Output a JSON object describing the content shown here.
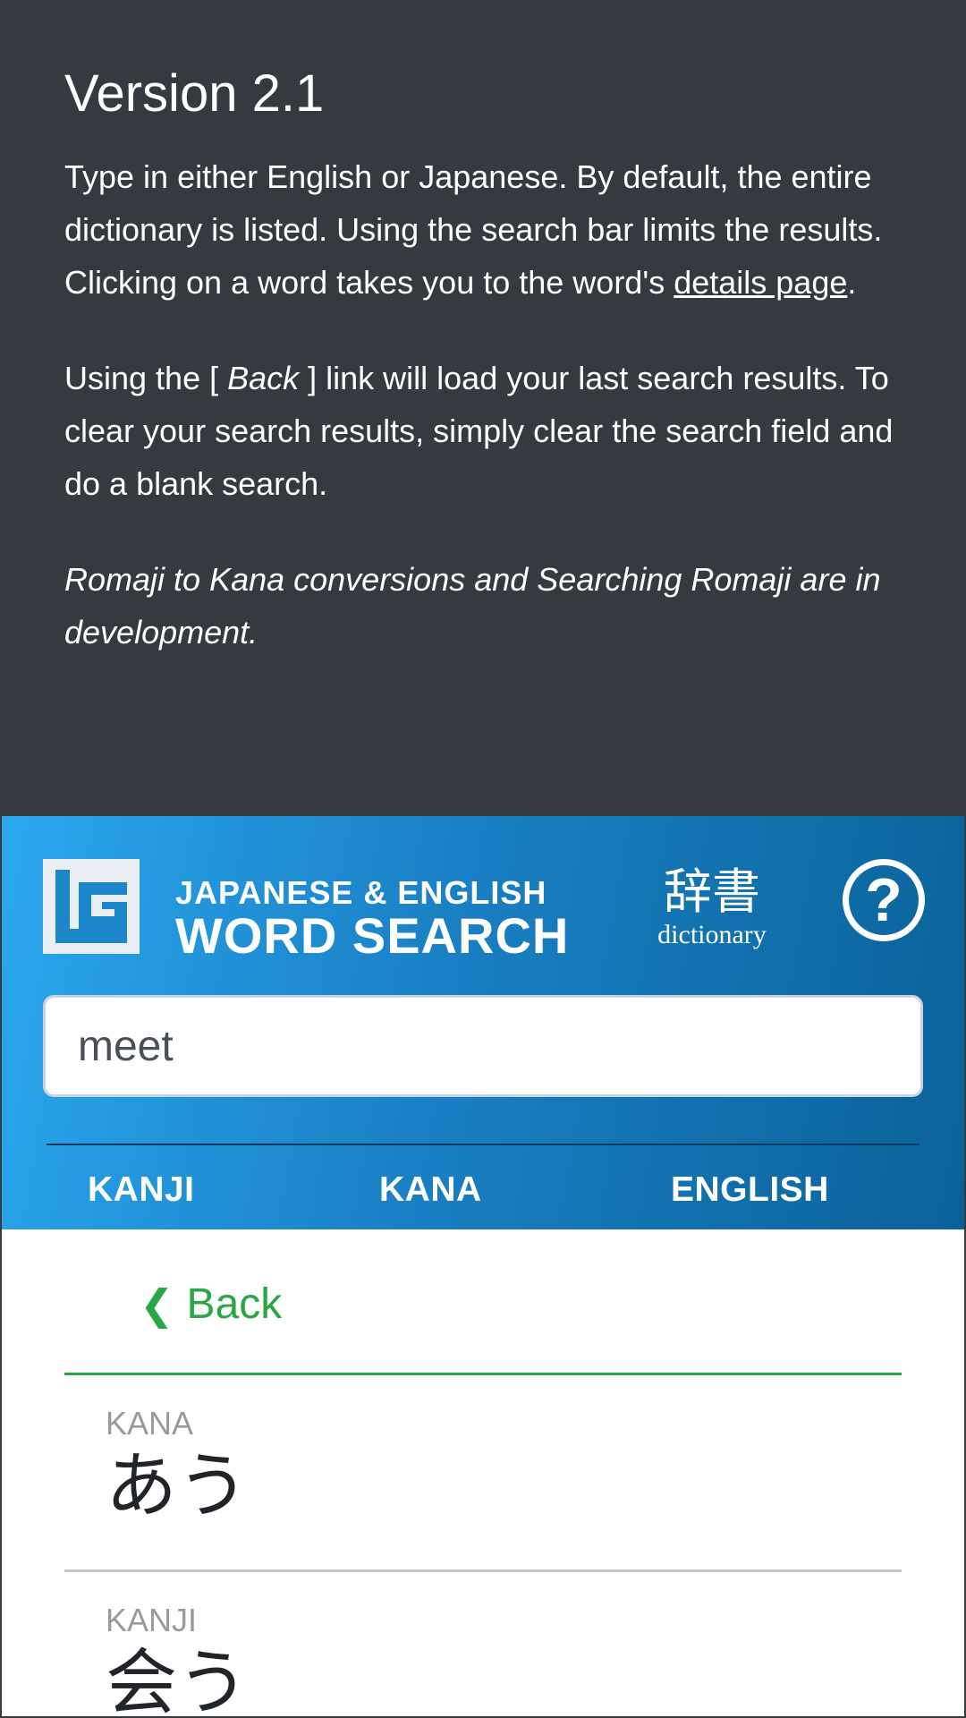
{
  "info": {
    "version_title": "Version 2.1",
    "p1_text": "Type in either English or Japanese. By default, the entire dictionary is listed. Using the search bar limits the results. Clicking on a word takes you to the word's ",
    "p1_link": "details page",
    "p1_end": ".",
    "p2_pre": "Using the [ ",
    "p2_em": "Back",
    "p2_post": " ] link will load your last search results. To clear your search results, simply clear the search field and do a blank search.",
    "p3": "Romaji to Kana conversions and Searching Romaji are in development."
  },
  "header": {
    "brand_top": "JAPANESE & ENGLISH",
    "brand_bottom": "WORD SEARCH",
    "jisho_kanji": "辞書",
    "jisho_word": "dictionary",
    "help_label": "?",
    "logo_icon": "lg-logo-icon",
    "gradient_start": "#2aa7ee",
    "gradient_end": "#0a6298"
  },
  "search": {
    "value": "meet"
  },
  "tabs": [
    {
      "label": "KANJI"
    },
    {
      "label": "KANA"
    },
    {
      "label": "ENGLISH"
    }
  ],
  "back": {
    "chevron": "❮",
    "label": "Back",
    "color": "#28a745"
  },
  "results": [
    {
      "label": "KANA",
      "value": "あう"
    },
    {
      "label": "KANJI",
      "value": "会う"
    }
  ]
}
